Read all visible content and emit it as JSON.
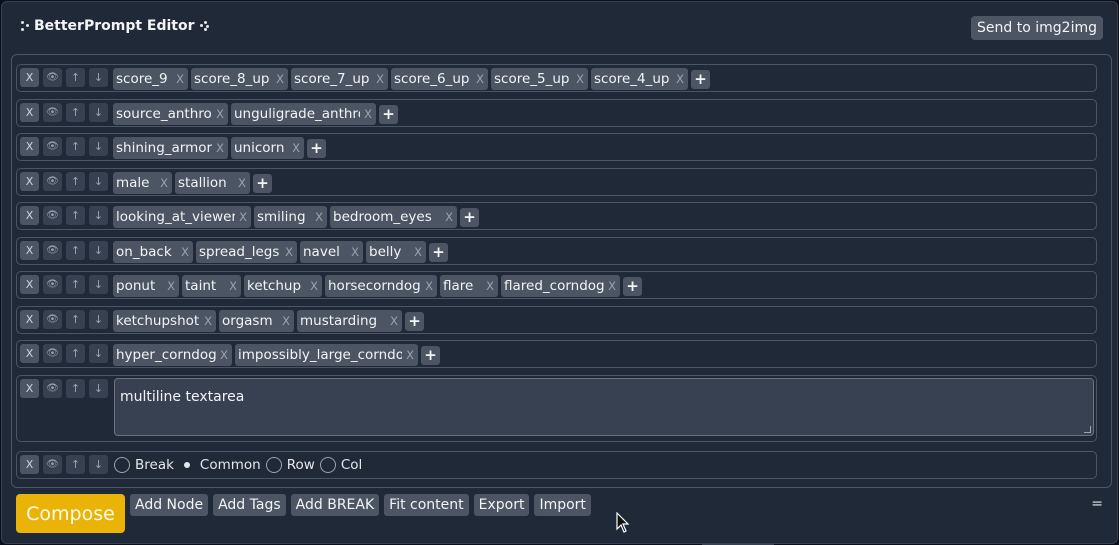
{
  "header": {
    "title": "BetterPrompt Editor",
    "send_button": "Send to img2img"
  },
  "node_controls": {
    "delete": "X",
    "toggle": "👁",
    "up": "↑",
    "down": "↓",
    "add": "+",
    "tag_remove": "X"
  },
  "nodes": [
    {
      "tags": [
        {
          "label": "score_9"
        },
        {
          "label": "score_8_up"
        },
        {
          "label": "score_7_up"
        },
        {
          "label": "score_6_up"
        },
        {
          "label": "score_5_up"
        },
        {
          "label": "score_4_up"
        }
      ]
    },
    {
      "tags": [
        {
          "label": "source_anthro"
        },
        {
          "label": "unguligrade_anthro"
        }
      ]
    },
    {
      "tags": [
        {
          "label": "shining_armor"
        },
        {
          "label": "unicorn"
        }
      ]
    },
    {
      "tags": [
        {
          "label": "male"
        },
        {
          "label": "stallion"
        }
      ]
    },
    {
      "tags": [
        {
          "label": "looking_at_viewer"
        },
        {
          "label": "smiling"
        },
        {
          "label": "bedroom_eyes"
        }
      ]
    },
    {
      "tags": [
        {
          "label": "on_back"
        },
        {
          "label": "spread_legs"
        },
        {
          "label": "navel"
        },
        {
          "label": "belly"
        }
      ]
    },
    {
      "tags": [
        {
          "label": "ponut"
        },
        {
          "label": "taint"
        },
        {
          "label": "ketchup"
        },
        {
          "label": "horsecorndog"
        },
        {
          "label": "flare"
        },
        {
          "label": "flared_corndog"
        }
      ]
    },
    {
      "tags": [
        {
          "label": "ketchupshot"
        },
        {
          "label": "orgasm"
        },
        {
          "label": "mustarding"
        }
      ]
    },
    {
      "tags": [
        {
          "label": "hyper_corndog"
        },
        {
          "label": "impossibly_large_corndog"
        }
      ]
    }
  ],
  "textarea_node": {
    "value": "multiline textarea"
  },
  "break_node": {
    "options": [
      {
        "label": "Break",
        "selected": false
      },
      {
        "label": "Common",
        "selected": true
      },
      {
        "label": "Row",
        "selected": false
      },
      {
        "label": "Col",
        "selected": false
      }
    ]
  },
  "footer": {
    "compose": "Compose",
    "buttons": [
      "Add Node",
      "Add Tags",
      "Add BREAK",
      "Fit content",
      "Export",
      "Import"
    ],
    "menu_glyph": "="
  },
  "colors": {
    "accent": "#eab308",
    "background": "#1f2937",
    "chip": "#4b5563"
  }
}
